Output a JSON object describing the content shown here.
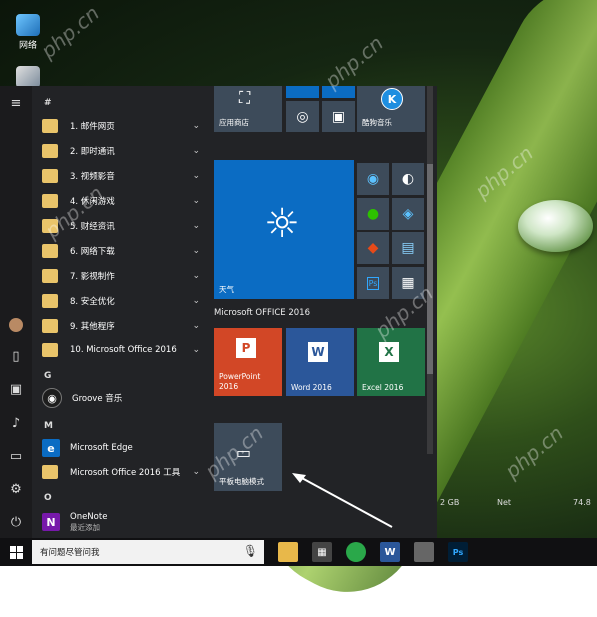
{
  "desktop": {
    "icons": [
      {
        "label": "网络",
        "icon": "network-icon"
      },
      {
        "label": "",
        "icon": "recycle-bin-icon"
      }
    ],
    "sysinfo": [
      "2 GB",
      "Net",
      "74.8"
    ]
  },
  "rail": {
    "icons": [
      "menu-icon",
      "user-avatar-icon",
      "documents-icon",
      "pictures-icon",
      "music-icon",
      "photos-icon",
      "settings-icon",
      "power-icon"
    ]
  },
  "applist": {
    "letters": {
      "hash": "#",
      "g": "G",
      "m": "M",
      "o": "O"
    },
    "folders": [
      "1. 邮件网页",
      "2. 即时通讯",
      "3. 视频影音",
      "4. 休闲游戏",
      "5. 财经资讯",
      "6. 网络下载",
      "7. 影视制作",
      "8. 安全优化",
      "9. 其他程序",
      "10. Microsoft Office 2016"
    ],
    "groove": "Groove 音乐",
    "edge": "Microsoft Edge",
    "office_tools": "Microsoft Office 2016 工具",
    "onenote": "OneNote",
    "onenote_sub": "最近添加"
  },
  "tiles": {
    "store": "应用商店",
    "kugou": "酷狗音乐",
    "kugou_glyph": "K",
    "weather": "天气",
    "office_group": "Microsoft OFFICE 2016",
    "powerpoint": "PowerPoint 2016",
    "word": "Word 2016",
    "excel": "Excel 2016",
    "tablet": "平板电脑模式",
    "ps": "Ps",
    "p_letter": "P",
    "w_letter": "W",
    "x_letter": "X",
    "e_letter": "e",
    "n_letter": "N"
  },
  "taskbar": {
    "search_placeholder": "有问题尽管问我",
    "apps": [
      "file-explorer-icon",
      "calculator-icon",
      "browser-360-icon",
      "word-icon",
      "unknown-app-icon",
      "photoshop-icon"
    ]
  },
  "watermark": "php.cn",
  "colors": {
    "accent_blue": "#0b6cc3",
    "powerpoint": "#d24726",
    "word": "#2b579a",
    "excel": "#217346",
    "start_bg": "#222326"
  }
}
